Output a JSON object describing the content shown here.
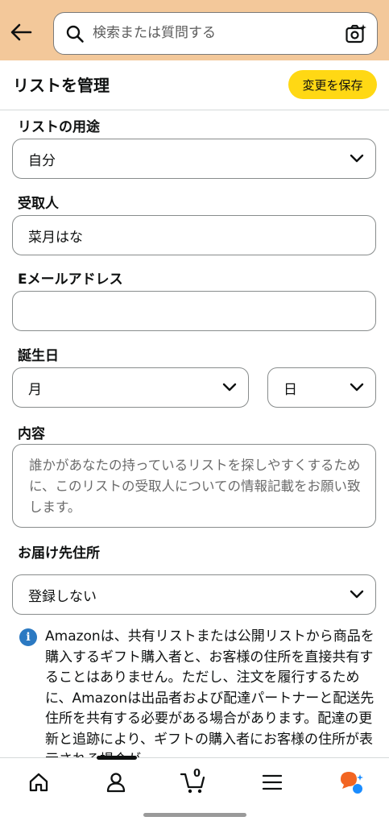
{
  "search": {
    "placeholder": "検索または質問する"
  },
  "header": {
    "title": "リストを管理",
    "save_label": "変更を保存"
  },
  "form": {
    "purpose": {
      "label": "リストの用途",
      "value": "自分"
    },
    "recipient": {
      "label": "受取人",
      "value": "菜月はな"
    },
    "email": {
      "label": "Eメールアドレス",
      "value": ""
    },
    "birthday": {
      "label": "誕生日",
      "month": "月",
      "day": "日"
    },
    "description": {
      "label": "内容",
      "placeholder": "誰かがあなたの持っているリストを探しやすくするために、このリストの受取人についての情報記載をお願い致します。"
    },
    "address": {
      "label": "お届け先住所",
      "value": "登録しない"
    }
  },
  "info": {
    "text": "Amazonは、共有リストまたは公開リストから商品を購入するギフト購入者と、お客様の住所を直接共有することはありません。ただし、注文を履行するために、Amazonは出品者および配達パートナーと配送先住所を共有する必要がある場合があります。配達の更新と追跡により、ギフトの購入者にお客様の住所が表示される場合が"
  },
  "nav": {
    "cart_count": "0"
  },
  "colors": {
    "topbar": "#f3c89a",
    "save_button": "#ffd814",
    "info_icon": "#2b79c2",
    "assistant_orange": "#f26522",
    "assistant_blue": "#1a8cff"
  },
  "icons": [
    "back-arrow-icon",
    "search-icon",
    "camera-icon",
    "chevron-down-icon",
    "info-icon",
    "home-icon",
    "account-icon",
    "cart-icon",
    "menu-icon",
    "assistant-icon"
  ]
}
